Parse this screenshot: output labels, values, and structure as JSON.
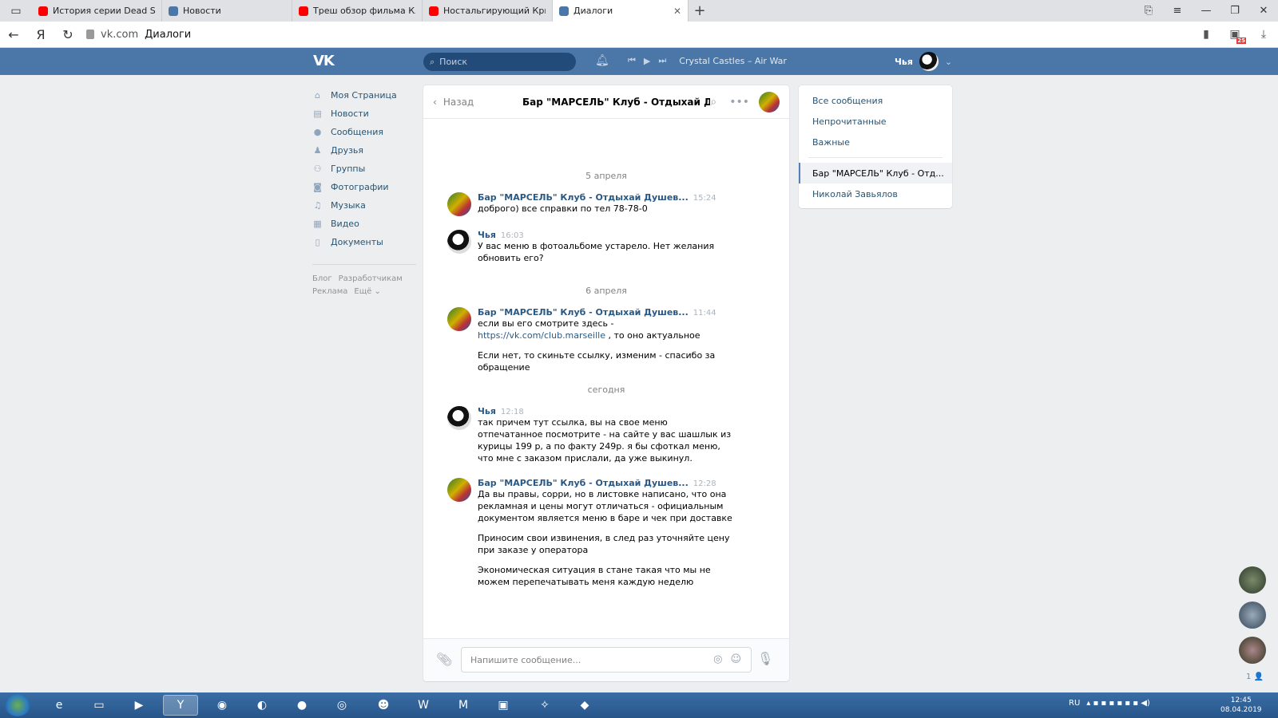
{
  "browser": {
    "tabs": [
      {
        "title": "История серии Dead Space",
        "icon": "youtube-icon",
        "color": "#ff0000"
      },
      {
        "title": "Новости",
        "icon": "vk-icon",
        "color": "#4a76a8"
      },
      {
        "title": "Треш обзор фильма КЛАД",
        "icon": "youtube-icon",
        "color": "#ff0000"
      },
      {
        "title": "Ностальгирующий Критик",
        "icon": "youtube-icon",
        "color": "#ff0000"
      },
      {
        "title": "Диалоги",
        "icon": "vk-icon",
        "color": "#4a76a8",
        "active": true
      }
    ],
    "address": {
      "domain": "vk.com",
      "page_title": "Диалоги"
    },
    "yandex_letter": "Я",
    "badge": "25"
  },
  "vk_header": {
    "search_placeholder": "Поиск",
    "track": "Crystal Castles – Air War",
    "user_name": "Чья"
  },
  "left_nav": {
    "items": [
      {
        "label": "Моя Страница",
        "icon": "home-icon"
      },
      {
        "label": "Новости",
        "icon": "news-icon"
      },
      {
        "label": "Сообщения",
        "icon": "messages-icon"
      },
      {
        "label": "Друзья",
        "icon": "friends-icon"
      },
      {
        "label": "Группы",
        "icon": "groups-icon"
      },
      {
        "label": "Фотографии",
        "icon": "photos-icon"
      },
      {
        "label": "Музыка",
        "icon": "music-icon"
      },
      {
        "label": "Видео",
        "icon": "video-icon"
      },
      {
        "label": "Документы",
        "icon": "documents-icon"
      }
    ],
    "footer": [
      "Блог",
      "Разработчикам",
      "Реклама",
      "Ещё ⌄"
    ]
  },
  "chat": {
    "back_label": "Назад",
    "title": "Бар \"МАРСЕЛЬ\" Клуб - Отдыхай Душ...",
    "dates": [
      "5 апреля",
      "6 апреля",
      "сегодня"
    ],
    "messages": [
      {
        "author": "Бар \"МАРСЕЛЬ\" Клуб - Отдыхай Душев...",
        "time": "15:24",
        "paragraphs": [
          "доброго) все справки по тел 78-78-0"
        ]
      },
      {
        "author": "Чья",
        "time": "16:03",
        "paragraphs": [
          "У вас меню в фотоальбоме устарело. Нет желания обновить его?"
        ]
      },
      {
        "author": "Бар \"МАРСЕЛЬ\" Клуб - Отдыхай Душев...",
        "time": "11:44",
        "p1_before": "если вы его смотрите здесь - ",
        "p1_link": "https://vk.com/club.marseille",
        "p1_after": " , то оно актуальное",
        "p2": "Если нет, то скиньте ссылку, изменим - спасибо за обращение"
      },
      {
        "author": "Чья",
        "time": "12:18",
        "paragraphs": [
          "так причем тут ссылка, вы на свое меню отпечатанное посмотрите - на сайте у вас шашлык из курицы 199 р, а по факту 249р. я бы сфоткал меню, что мне с заказом прислали, да уже выкинул."
        ]
      },
      {
        "author": "Бар \"МАРСЕЛЬ\" Клуб - Отдыхай Душев...",
        "time": "12:28",
        "paragraphs": [
          "Да вы правы, сорри, но в листовке написано, что она рекламная и цены могут отличаться - официальным документом является меню в баре и чек при доставке",
          "Приносим свои извинения, в след раз уточняйте цену при заказе у оператора",
          "Экономическая ситуация в стане такая что мы не можем перепечатывать меня каждую неделю"
        ]
      }
    ],
    "composer_placeholder": "Напишите сообщение..."
  },
  "right_nav": {
    "filters": [
      "Все сообщения",
      "Непрочитанные",
      "Важные"
    ],
    "dialogs": [
      "Бар \"МАРСЕЛЬ\" Клуб - Отд...",
      "Николай Завьялов"
    ]
  },
  "float_count": "1 👤",
  "taskbar": {
    "lang": "RU",
    "time": "12:45",
    "date": "08.04.2019"
  }
}
